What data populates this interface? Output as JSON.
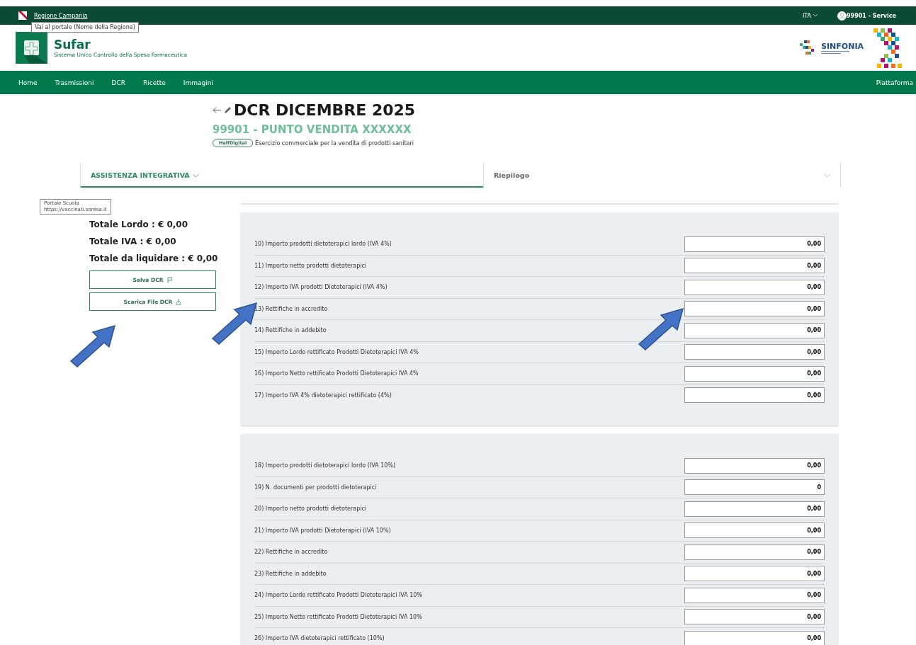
{
  "top_bar": {
    "region_link": "Regione Campania",
    "region_tooltip": "Vai al portale (Nome della Regione)",
    "language": "ITA",
    "user": "99901 - Service"
  },
  "header": {
    "app_name": "Sufar",
    "app_subtitle": "Sistema Unico Controllo della Spesa Farmaceutica",
    "partner_name": "SINFONIA"
  },
  "nav": {
    "items": [
      "Home",
      "Trasmissioni",
      "DCR",
      "Ricette",
      "Immagini"
    ],
    "right": "Piattaforma"
  },
  "page": {
    "title": "DCR DICEMBRE 2025",
    "subtitle": "99901 - PUNTO VENDITA XXXXXX",
    "badge": "HalfDigital",
    "description": "Esercizio commerciale per la vendita di prodotti sanitari"
  },
  "tabs": [
    {
      "label": "ASSISTENZA INTEGRATIVA",
      "selected": true
    },
    {
      "label": "Riepilogo",
      "selected": false
    }
  ],
  "tooltip": {
    "title": "Portale Scuola",
    "url": "https://vaccinati.soresa.it"
  },
  "totals": [
    "Totale Lordo : € 0,00",
    "Totale IVA : € 0,00",
    "Totale da liquidare : € 0,00"
  ],
  "actions": [
    {
      "label": "Salva DCR",
      "kind": "save"
    },
    {
      "label": "Scarica File DCR",
      "kind": "download"
    }
  ],
  "sections": [
    {
      "rows": [
        {
          "label": "10) Importo prodotti dietoterapici lordo (IVA 4%)",
          "value": "0,00"
        },
        {
          "label": "11) Importo netto prodotti dietoterapici",
          "value": "0,00"
        },
        {
          "label": "12) Importo IVA prodotti Dietoterapici (IVA 4%)",
          "value": "0,00"
        },
        {
          "label": "13) Rettifiche in accredito",
          "value": "0,00"
        },
        {
          "label": "14) Rettifiche in addebito",
          "value": "0,00"
        },
        {
          "label": "15) Importo Lordo rettificato Prodotti Dietoterapici IVA 4%",
          "value": "0,00"
        },
        {
          "label": "16) Importo Netto rettificato Prodotti Dietoterapici IVA 4%",
          "value": "0,00"
        },
        {
          "label": "17) Importo IVA 4% dietoterapici rettificato (4%)",
          "value": "0,00"
        }
      ]
    },
    {
      "rows": [
        {
          "label": "18) Importo prodotti dietoterapici lordo (IVA 10%)",
          "value": "0,00"
        },
        {
          "label": "19) N. documenti per prodotti dietoterapici",
          "value": "0"
        },
        {
          "label": "20) Importo netto prodotti dietoterapici",
          "value": "0,00"
        },
        {
          "label": "21) Importo IVA prodotti Dietoterapici (IVA 10%)",
          "value": "0,00"
        },
        {
          "label": "22) Rettifiche in accredito",
          "value": "0,00"
        },
        {
          "label": "23) Rettifiche in addebito",
          "value": "0,00"
        },
        {
          "label": "24) Importo Lordo rettificato Prodotti Dietoterapici IVA 10%",
          "value": "0,00"
        },
        {
          "label": "25) Importo Netto rettificato Prodotti Dietoterapici IVA 10%",
          "value": "0,00"
        },
        {
          "label": "26) Importo IVA dietoterapici rettificato (10%)",
          "value": "0,00"
        }
      ]
    }
  ]
}
